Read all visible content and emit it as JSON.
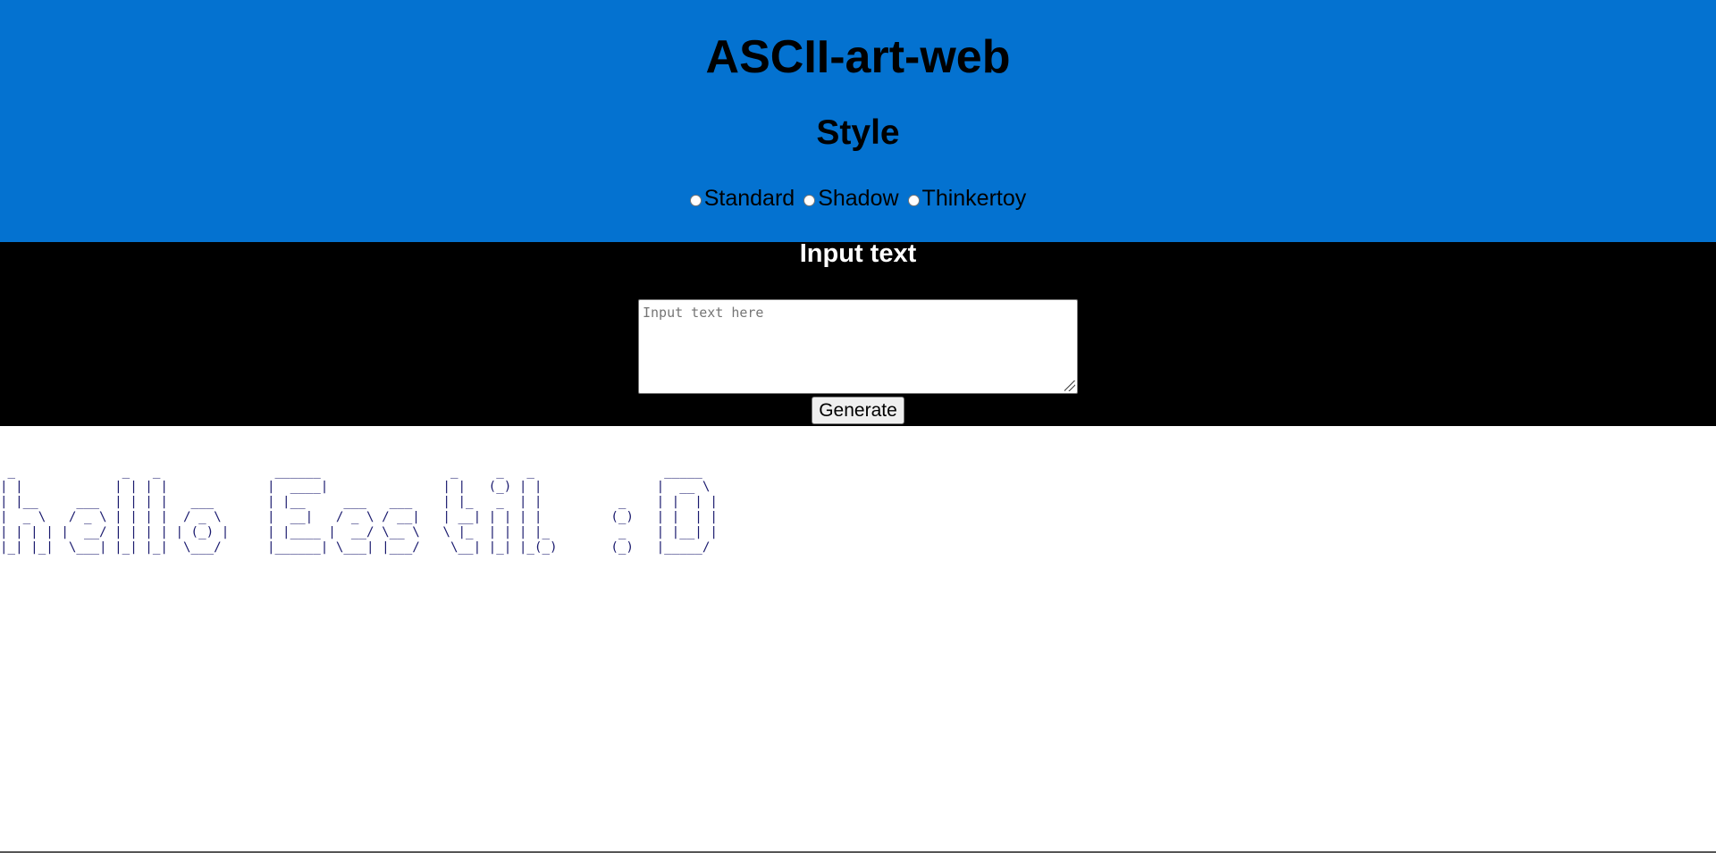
{
  "header": {
    "title": "ASCII-art-web",
    "style_heading": "Style",
    "style_options": [
      "Standard",
      "Shadow",
      "Thinkertoy"
    ]
  },
  "input_section": {
    "heading": "Input text",
    "textarea_placeholder": "Input text here",
    "textarea_value": "",
    "generate_label": "Generate"
  },
  "output": {
    "ascii_art": " _              _   _               ______                 _     _   _                 _____  \n| |            | | | |             |  ____|               | |   (_) | |               |  __ \\ \n| |__     ___  | | | |   ___       | |__     ___   ___    | |_   _  | |          _    | |  | |\n|  _ \\   / _ \\ | | | |  / _ \\      |  __|   / _ \\ / __|   | __| | | | |         (_)   | |  | |\n| | | | |  __/ | | | | | (_) |     | |____ |  __/ \\__ \\   \\ |_  | | | |_         _    | |__| |\n|_| |_|  \\___| |_| |_|  \\___/      |______| \\___| |___/    \\__| |_| |_(_)       (_)   |_____/ "
  },
  "colors": {
    "header_bg": "#0472d0",
    "input_section_bg": "#000000",
    "ascii_text": "#1a1a6e"
  }
}
